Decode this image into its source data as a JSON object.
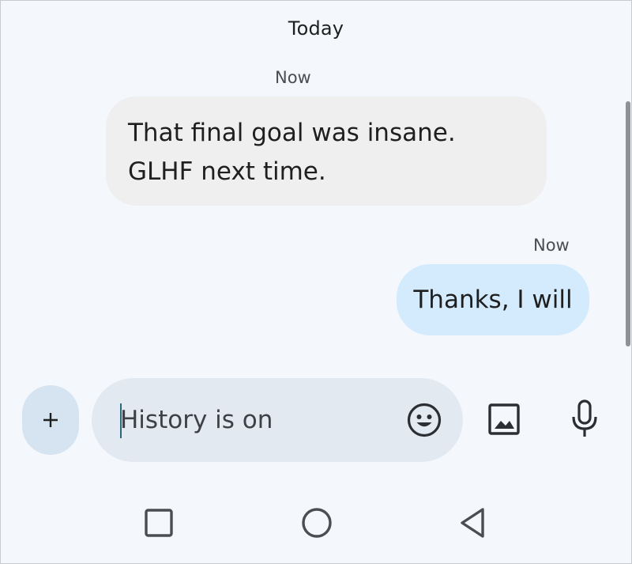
{
  "conversation": {
    "date_header": "Today",
    "messages": [
      {
        "direction": "incoming",
        "timestamp": "Now",
        "lines": [
          "That final goal was insane.",
          "GLHF next time."
        ]
      },
      {
        "direction": "outgoing",
        "timestamp": "Now",
        "lines": [
          "Thanks, I will"
        ]
      }
    ]
  },
  "composer": {
    "plus_label": "+",
    "placeholder": "History is on",
    "emoji_icon": "emoji-icon",
    "image_icon": "image-icon",
    "mic_icon": "microphone-icon"
  },
  "navbar": {
    "recent_icon": "square-recents-icon",
    "home_icon": "circle-home-icon",
    "back_icon": "triangle-back-icon"
  },
  "colors": {
    "background": "#f4f8fc",
    "incoming_bubble": "#efeff0",
    "outgoing_bubble": "#d3ebfd",
    "compose_field": "#e3e9f1",
    "plus_button": "#d6e3f1"
  }
}
